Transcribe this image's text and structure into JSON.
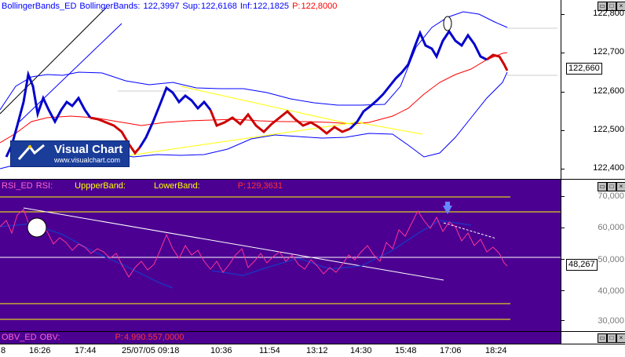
{
  "price_panel": {
    "indicator_name": "BollingerBands_ED",
    "indicator_params": "BollingerBands:",
    "value": "122,3997",
    "sup_label": "Sup:",
    "sup_value": "122,6168",
    "inf_label": "Inf:",
    "inf_value": "122,1825",
    "p_label": "P:",
    "p_value": "122,8000",
    "current_price": "122,660",
    "y_ticks": [
      "122,800",
      "122,700",
      "122,600",
      "122,500",
      "122,400"
    ],
    "colors": {
      "bands": "#0000ff",
      "average": "#ff0000",
      "trend": "#ffff00",
      "candles_up": "#0000cc",
      "candles_down": "#cc0000"
    }
  },
  "rsi_panel": {
    "indicator_name": "RSI_ED",
    "rsi_label": "RSI:",
    "upper_label": "UppperBand:",
    "lower_label": "LowerBand:",
    "p_label": "P:",
    "p_value": "129,3631",
    "current_value": "48,267",
    "y_ticks": [
      "70,000",
      "60,000",
      "50,000",
      "40,000",
      "30,000"
    ],
    "colors": {
      "background": "#4b0091",
      "rsi_line": "#ff3399",
      "avg_line": "#2030c0",
      "levels": "#ffff00"
    }
  },
  "obv_panel": {
    "indicator_name": "OBV_ED",
    "obv_label": "OBV:",
    "p_label": "P:",
    "p_value": "4.990.557,0000"
  },
  "logo": {
    "title": "Visual Chart",
    "url": "www.visualchart.com"
  },
  "time_axis": [
    "8",
    "16:26",
    "17:44",
    "25/07/05 09:18",
    "10:36",
    "11:54",
    "13:12",
    "14:30",
    "15:48",
    "17:06",
    "18:24"
  ],
  "window_buttons": [
    "restore",
    "maximize",
    "close"
  ]
}
